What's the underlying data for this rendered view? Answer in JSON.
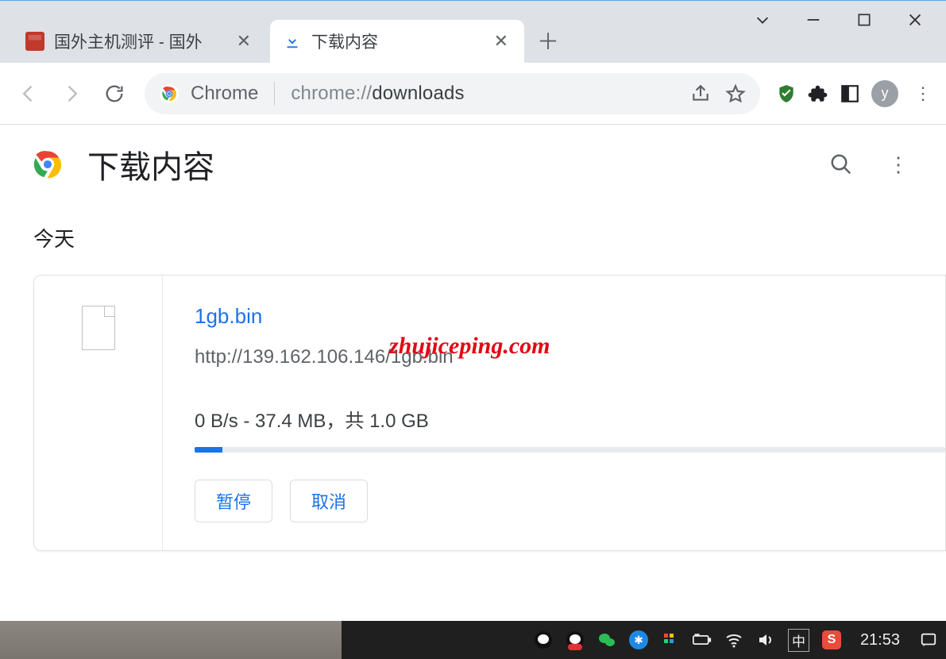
{
  "tabs": [
    {
      "label": "国外主机测评 - 国外"
    },
    {
      "label": "下载内容"
    }
  ],
  "omnibox": {
    "chrome_label": "Chrome",
    "url_prefix": "chrome://",
    "url_path": "downloads"
  },
  "avatar_letter": "y",
  "downloads": {
    "header_title": "下载内容",
    "section": "今天",
    "item": {
      "name": "1gb.bin",
      "url": "http://139.162.106.146/1gb.bin",
      "status": "0 B/s - 37.4 MB，共 1.0 GB",
      "pause_label": "暂停",
      "cancel_label": "取消"
    }
  },
  "watermark": "zhujiceping.com",
  "taskbar": {
    "ime": "中",
    "sogou": "S",
    "clock": "21:53"
  }
}
